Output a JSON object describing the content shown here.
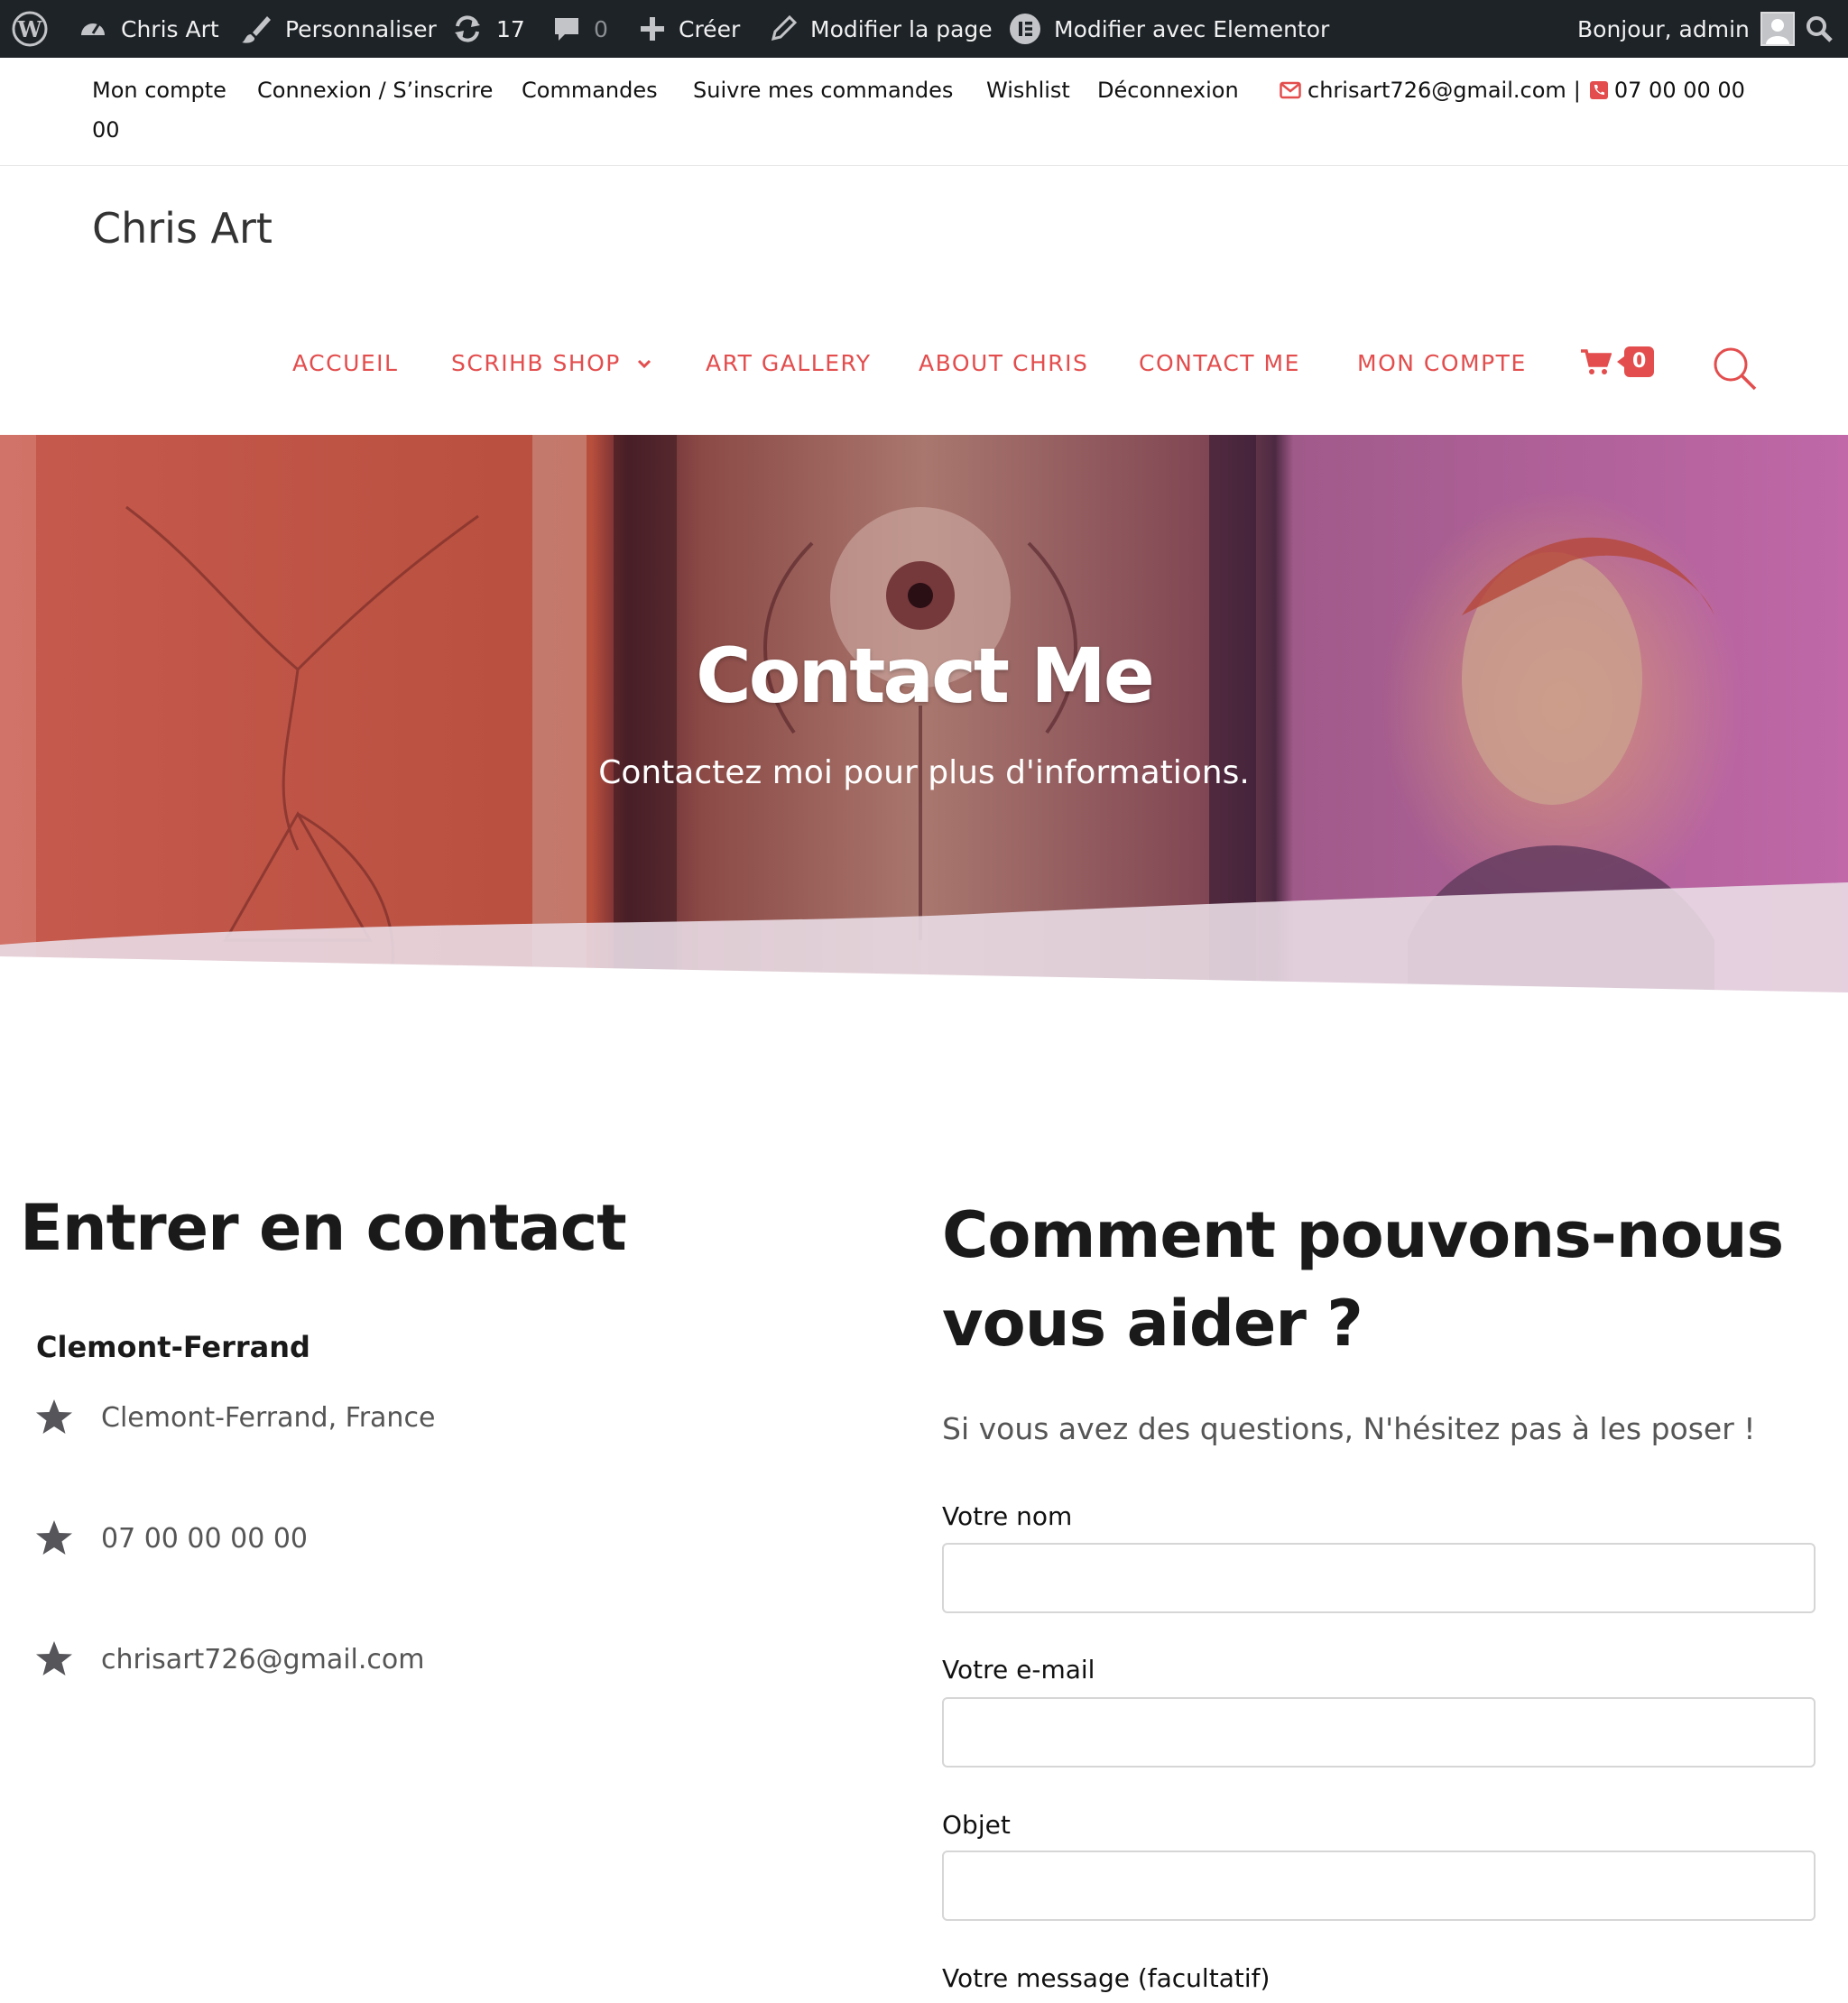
{
  "admin_bar": {
    "site_name": "Chris Art",
    "customize": "Personnaliser",
    "updates_count": "17",
    "comments_count": "0",
    "new": "Créer",
    "edit_page": "Modifier la page",
    "edit_elementor": "Modifier avec Elementor",
    "greeting": "Bonjour, admin"
  },
  "top_bar": {
    "links": [
      "Mon compte",
      "Connexion / S’inscrire",
      "Commandes",
      "Suivre mes commandes",
      "Wishlist",
      "Déconnexion"
    ],
    "email": "chrisart726@gmail.com",
    "separator": "|",
    "phone_line1": "07 00 00 00",
    "phone_line2": "00"
  },
  "header": {
    "site_title": "Chris Art",
    "menu": [
      "ACCUEIL",
      "SCRIHB SHOP",
      "ART GALLERY",
      "ABOUT CHRIS",
      "CONTACT ME",
      "MON COMPTE"
    ],
    "cart_count": "0"
  },
  "hero": {
    "title": "Contact Me",
    "subtitle": "Contactez moi pour plus d'informations."
  },
  "contact_info": {
    "heading": "Entrer en contact",
    "city": "Clemont-Ferrand",
    "items": [
      "Clemont-Ferrand, France",
      "07 00 00 00 00",
      "chrisart726@gmail.com"
    ]
  },
  "form": {
    "heading_line1": "Comment pouvons-nous",
    "heading_line2": "vous aider ?",
    "intro": "Si vous avez des questions, N'hésitez pas à les poser !",
    "name_label": "Votre nom",
    "email_label": "Votre e-mail",
    "subject_label": "Objet",
    "message_label": "Votre message (facultatif)"
  },
  "colors": {
    "accent": "#e34d4d",
    "admin_bar_bg": "#1d2327",
    "heading": "#1a1a1a"
  }
}
